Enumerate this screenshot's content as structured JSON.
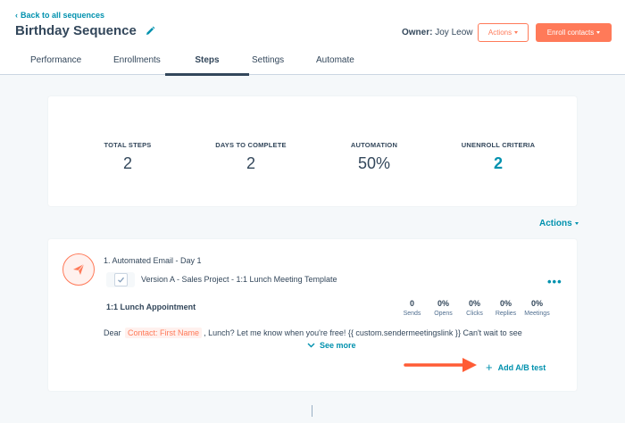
{
  "header": {
    "back_link": "Back to all sequences",
    "title": "Birthday Sequence",
    "owner_label": "Owner:",
    "owner_name": "Joy Leow",
    "actions_button": "Actions",
    "enroll_button": "Enroll contacts"
  },
  "tabs": [
    {
      "label": "Performance"
    },
    {
      "label": "Enrollments"
    },
    {
      "label": "Steps"
    },
    {
      "label": "Settings"
    },
    {
      "label": "Automate"
    }
  ],
  "stats": [
    {
      "label": "TOTAL STEPS",
      "value": "2"
    },
    {
      "label": "DAYS TO COMPLETE",
      "value": "2"
    },
    {
      "label": "AUTOMATION",
      "value": "50%"
    },
    {
      "label": "UNENROLL CRITERIA",
      "value": "2"
    }
  ],
  "actions_link": "Actions",
  "step": {
    "title": "1. Automated Email - Day 1",
    "version": "Version A - Sales Project - 1:1 Lunch Meeting Template",
    "subject": "1:1 Lunch Appointment",
    "metrics": [
      {
        "value": "0",
        "label": "Sends"
      },
      {
        "value": "0%",
        "label": "Opens"
      },
      {
        "value": "0%",
        "label": "Clicks"
      },
      {
        "value": "0%",
        "label": "Replies"
      },
      {
        "value": "0%",
        "label": "Meetings"
      }
    ],
    "body_prefix": "Dear",
    "body_token": "Contact: First Name",
    "body_suffix": ", Lunch? Let me know when you're free! {{ custom.sendermeetingslink }} Can't wait to see",
    "see_more": "See more",
    "add_ab": "Add A/B test",
    "more_icon": "ellipsis-icon"
  },
  "colors": {
    "accent": "#ff7a59",
    "link": "#0091ae",
    "text": "#33475b",
    "background": "#f5f8fa"
  }
}
